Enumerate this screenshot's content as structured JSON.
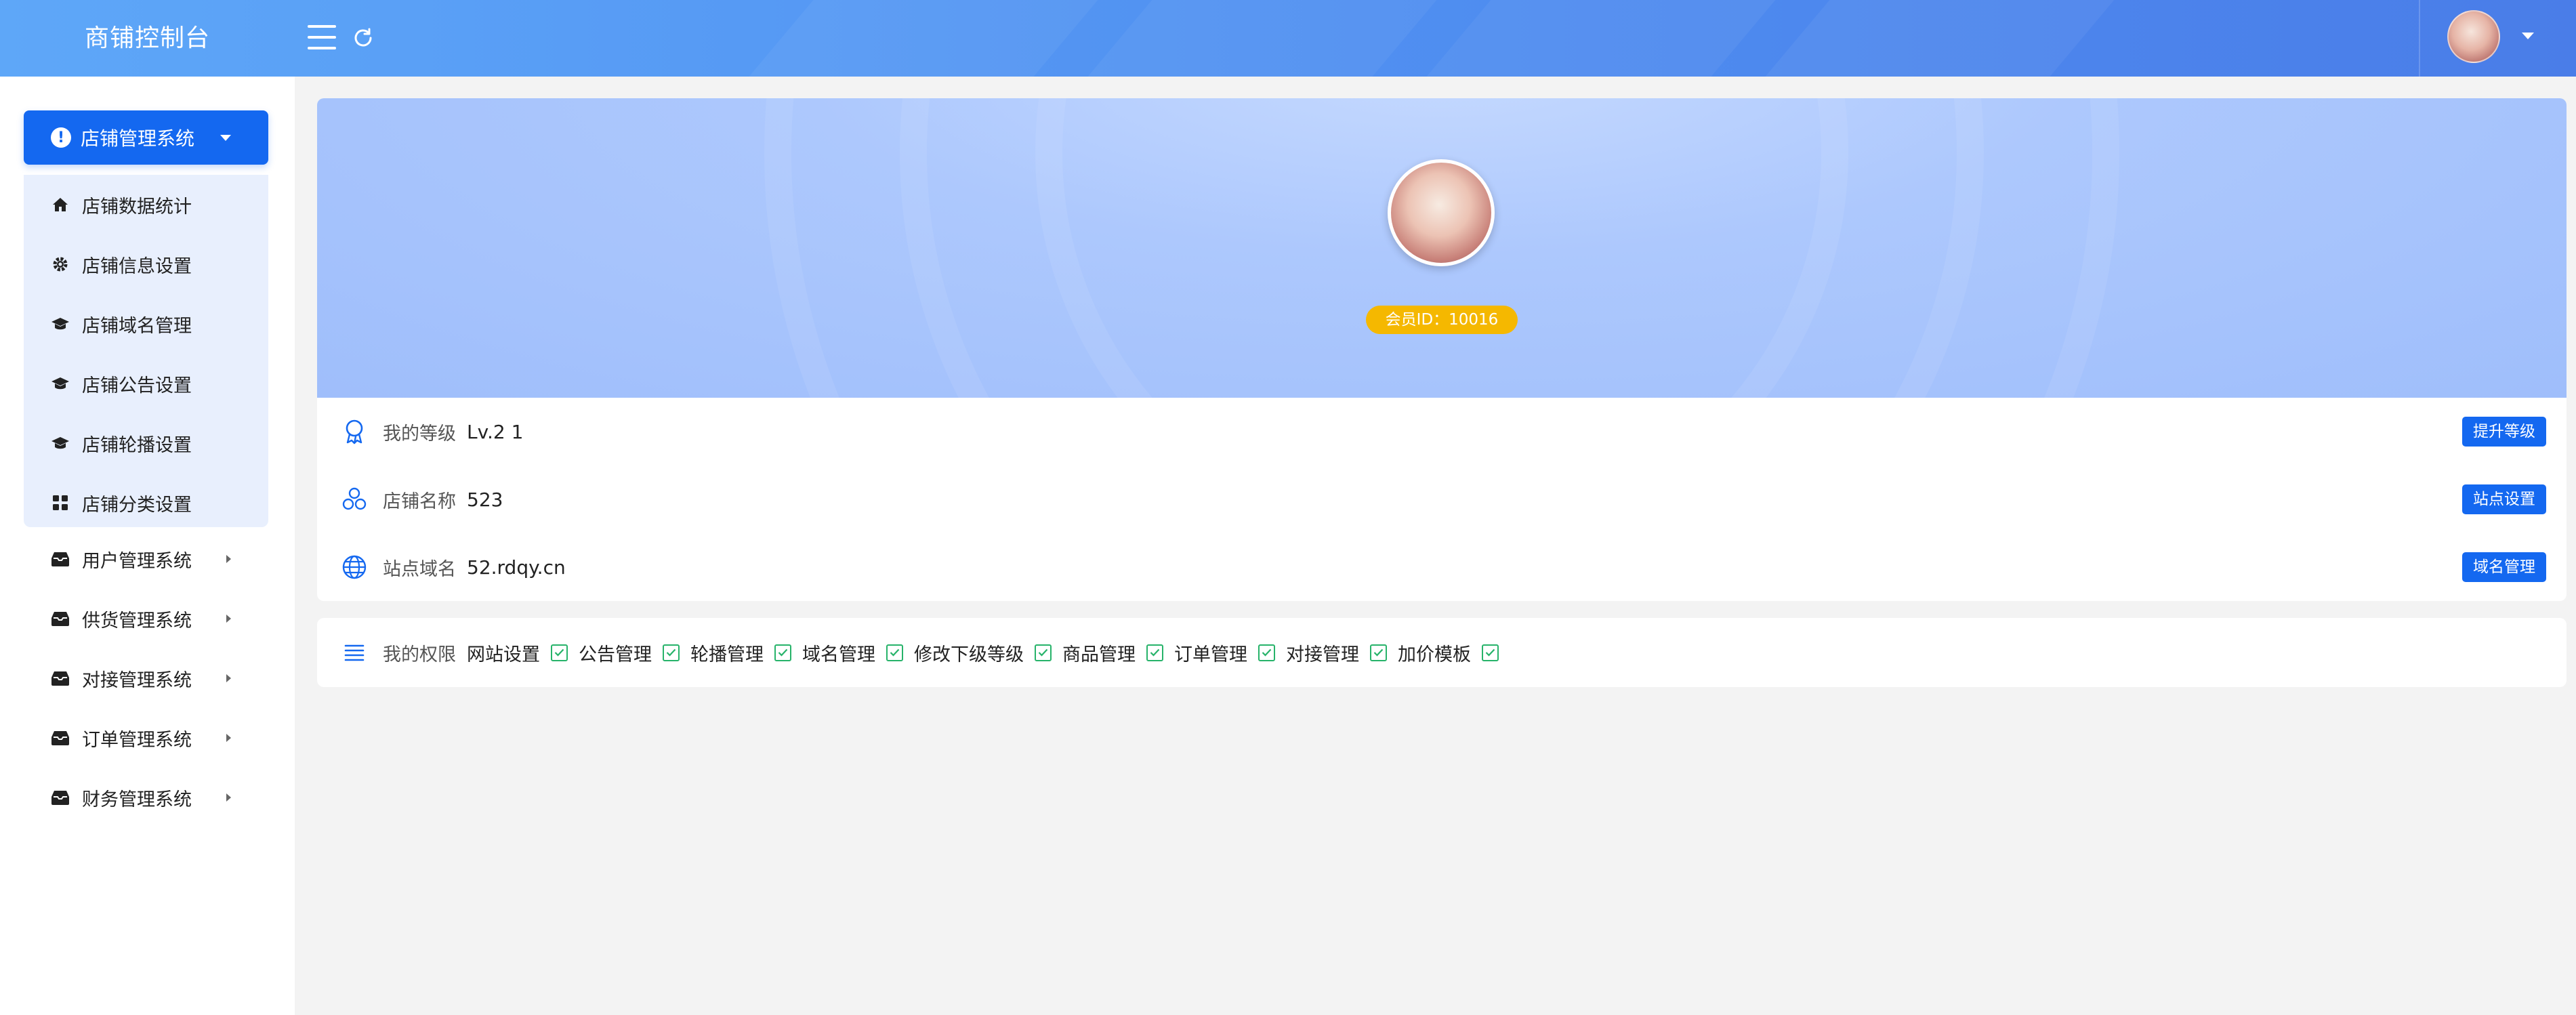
{
  "header": {
    "brand": "商铺控制台",
    "icons": {
      "menu": "hamburger-icon",
      "refresh": "refresh-icon",
      "user_caret": "caret-down-icon"
    }
  },
  "sidebar": {
    "active_group": {
      "label": "店铺管理系统",
      "icon": "alert-circle-icon"
    },
    "sub_items": [
      {
        "label": "店铺数据统计",
        "icon": "home-icon"
      },
      {
        "label": "店铺信息设置",
        "icon": "gear-icon"
      },
      {
        "label": "店铺域名管理",
        "icon": "graduation-cap-icon"
      },
      {
        "label": "店铺公告设置",
        "icon": "graduation-cap-icon"
      },
      {
        "label": "店铺轮播设置",
        "icon": "graduation-cap-icon"
      },
      {
        "label": "店铺分类设置",
        "icon": "grid-icon"
      }
    ],
    "groups": [
      {
        "label": "用户管理系统",
        "icon": "inbox-icon"
      },
      {
        "label": "供货管理系统",
        "icon": "inbox-icon"
      },
      {
        "label": "对接管理系统",
        "icon": "inbox-icon"
      },
      {
        "label": "订单管理系统",
        "icon": "inbox-icon"
      },
      {
        "label": "财务管理系统",
        "icon": "inbox-icon"
      }
    ]
  },
  "profile": {
    "member_badge": "会员ID：10016",
    "rows": [
      {
        "label": "我的等级",
        "value": "Lv.2 1",
        "button": "提升等级",
        "icon": "medal-icon"
      },
      {
        "label": "店铺名称",
        "value": "523",
        "button": "站点设置",
        "icon": "cubes-icon"
      },
      {
        "label": "站点域名",
        "value": "52.rdqy.cn",
        "button": "域名管理",
        "icon": "globe-icon"
      }
    ]
  },
  "permissions": {
    "label": "我的权限",
    "icon": "list-icon",
    "items": [
      "网站设置",
      "公告管理",
      "轮播管理",
      "域名管理",
      "修改下级等级",
      "商品管理",
      "订单管理",
      "对接管理",
      "加价模板"
    ]
  },
  "colors": {
    "accent": "#1468f0",
    "badge": "#f5b800",
    "check": "#27b36a",
    "banner": "#adc8fd"
  }
}
